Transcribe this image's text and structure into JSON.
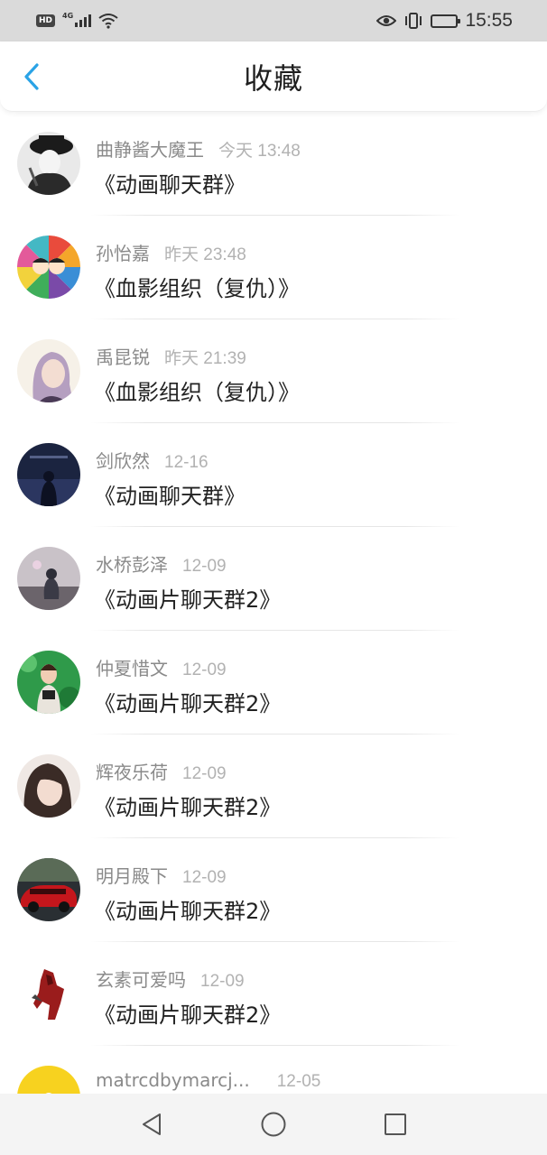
{
  "status_bar": {
    "hd": "HD",
    "network": "4G",
    "time": "15:55"
  },
  "header": {
    "title": "收藏",
    "back_icon": "chevron-left-icon",
    "accent_color": "#2aa3e6"
  },
  "favorites": [
    {
      "name": "曲静酱大魔王",
      "date": "今天 13:48",
      "title": "《动画聊天群》"
    },
    {
      "name": "孙怡嘉",
      "date": "昨天 23:48",
      "title": "《血影组织（复仇）》"
    },
    {
      "name": "禹昆锐",
      "date": "昨天 21:39",
      "title": "《血影组织（复仇）》"
    },
    {
      "name": "剑欣然",
      "date": "12-16",
      "title": "《动画聊天群》"
    },
    {
      "name": "水桥彭泽",
      "date": "12-09",
      "title": "《动画片聊天群2》"
    },
    {
      "name": "仲夏惜文",
      "date": "12-09",
      "title": "《动画片聊天群2》"
    },
    {
      "name": "辉夜乐荷",
      "date": "12-09",
      "title": "《动画片聊天群2》"
    },
    {
      "name": "明月殿下",
      "date": "12-09",
      "title": "《动画片聊天群2》"
    },
    {
      "name": "玄素可爱吗",
      "date": "12-09",
      "title": "《动画片聊天群2》"
    },
    {
      "name": "matrcdbymarcj...",
      "date": "12-05",
      "title": ""
    }
  ],
  "nav_bar": {
    "back": "triangle-back-icon",
    "home": "circle-home-icon",
    "recent": "square-recent-icon"
  }
}
